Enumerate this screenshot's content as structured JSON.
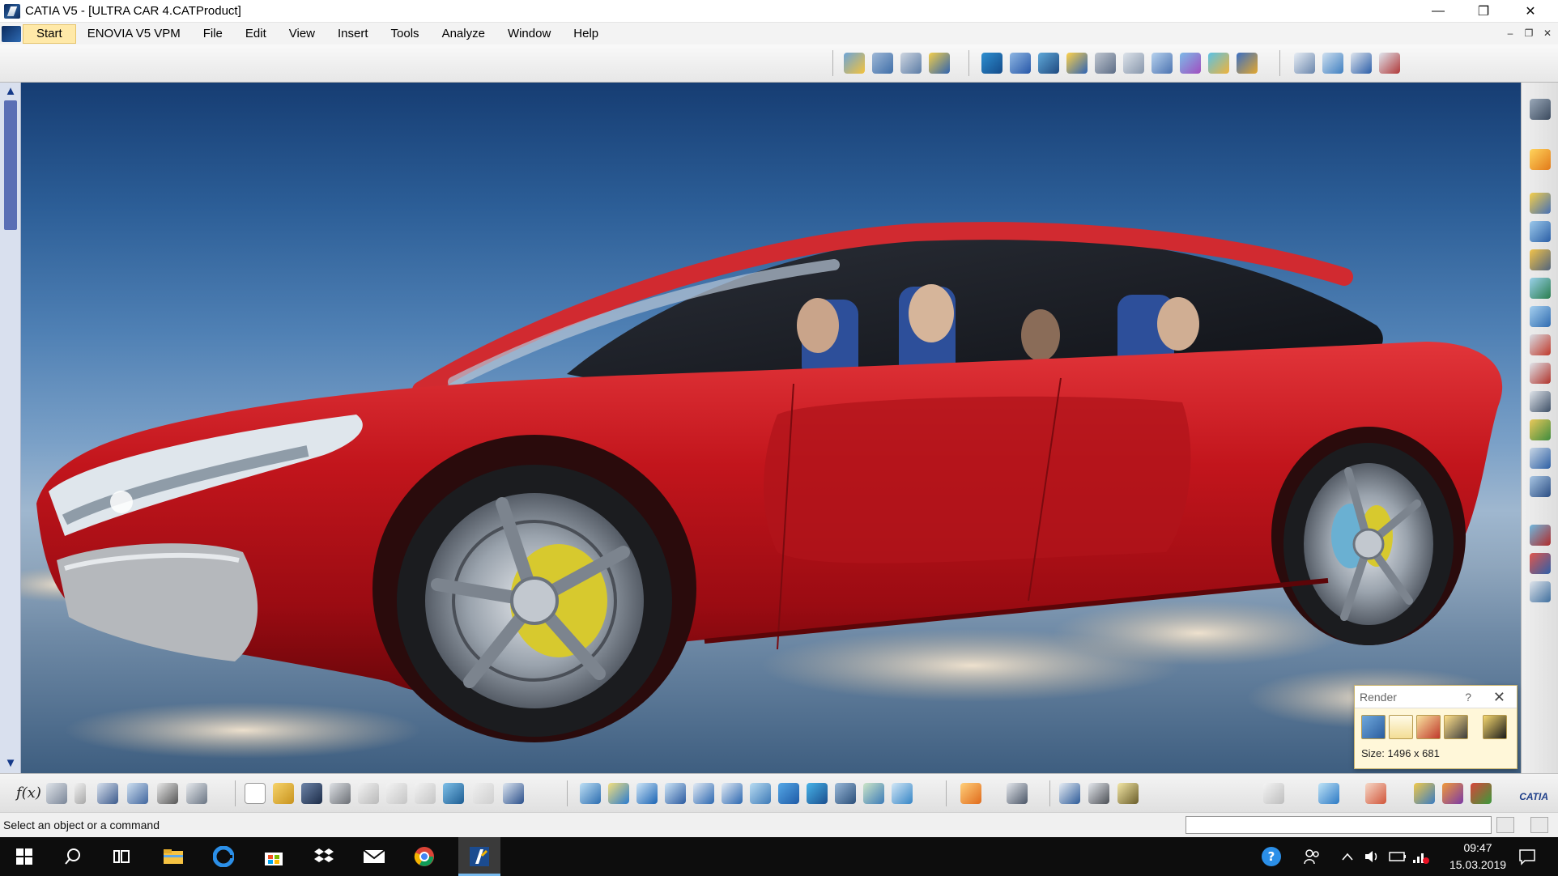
{
  "window": {
    "title": "CATIA V5 - [ULTRA CAR 4.CATProduct]",
    "minimize_glyph": "—",
    "maximize_glyph": "❐",
    "close_glyph": "✕"
  },
  "menubar": {
    "items": [
      "Start",
      "ENOVIA V5 VPM",
      "File",
      "Edit",
      "View",
      "Insert",
      "Tools",
      "Analyze",
      "Window",
      "Help"
    ],
    "mdi_minimize": "–",
    "mdi_restore": "❐",
    "mdi_close": "✕"
  },
  "viewport": {
    "scroll_up": "▲",
    "scroll_down": "▼"
  },
  "render_dialog": {
    "title": "Render",
    "help": "?",
    "close": "✕",
    "size_text": "Size: 1496 x 681"
  },
  "bottom_toolbar": {
    "formula_label": "f(x)",
    "catia_logo": "CATIA"
  },
  "status": {
    "message": "Select an object or a command",
    "command_value": ""
  },
  "taskbar": {
    "time": "09:47",
    "date": "15.03.2019"
  },
  "colors": {
    "car_body": "#c2151c",
    "menu_start_bg": "#ffe9a8",
    "scroll_thumb": "#5a6fb5",
    "taskbar_bg": "#0d0d0d"
  },
  "icons": {
    "top_toolbar": [
      "assembly-icon",
      "constraint-icon",
      "explode-icon",
      "move-icon",
      "catalog-icon",
      "part-icon",
      "product-icon",
      "component-icon",
      "replace-icon",
      "measure-icon",
      "clash-icon",
      "section-icon",
      "update-icon",
      "scene-icon",
      "view-icon",
      "space-analysis-icon",
      "tree-icon",
      "filter-icon"
    ],
    "right_toolbar": [
      "select-icon",
      "fix-icon",
      "coincidence-icon",
      "contact-icon",
      "offset-icon",
      "angle-icon",
      "fix-together-icon",
      "reuse-pattern-icon",
      "flexible-icon",
      "catalog-browser-icon",
      "publication-icon",
      "tree-expand-icon",
      "mechanism-icon",
      "bom-icon",
      "render-icon",
      "light-icon"
    ],
    "bottom_toolbar": [
      "formula-icon",
      "knowledge-icon",
      "rule-icon",
      "table-icon",
      "param-icon",
      "check-icon",
      "reaction-icon",
      "new-icon",
      "open-icon",
      "save-icon",
      "print-icon",
      "cut-icon",
      "copy-icon",
      "paste-icon",
      "undo-icon",
      "redo-icon",
      "whats-this-icon",
      "fly-icon",
      "fit-all-icon",
      "pan-icon",
      "rotate-icon",
      "zoom-in-icon",
      "zoom-out-icon",
      "normal-view-icon",
      "multi-view-icon",
      "iso-view-icon",
      "shading-icon",
      "hide-show-icon",
      "swap-icon",
      "capture-icon",
      "apply-material-icon",
      "measure-between-icon",
      "measure-item-icon",
      "measure-inertia-icon",
      "update-all-icon",
      "plane-icon",
      "grid-icon",
      "material-icon",
      "texture-icon",
      "environment-icon"
    ]
  }
}
